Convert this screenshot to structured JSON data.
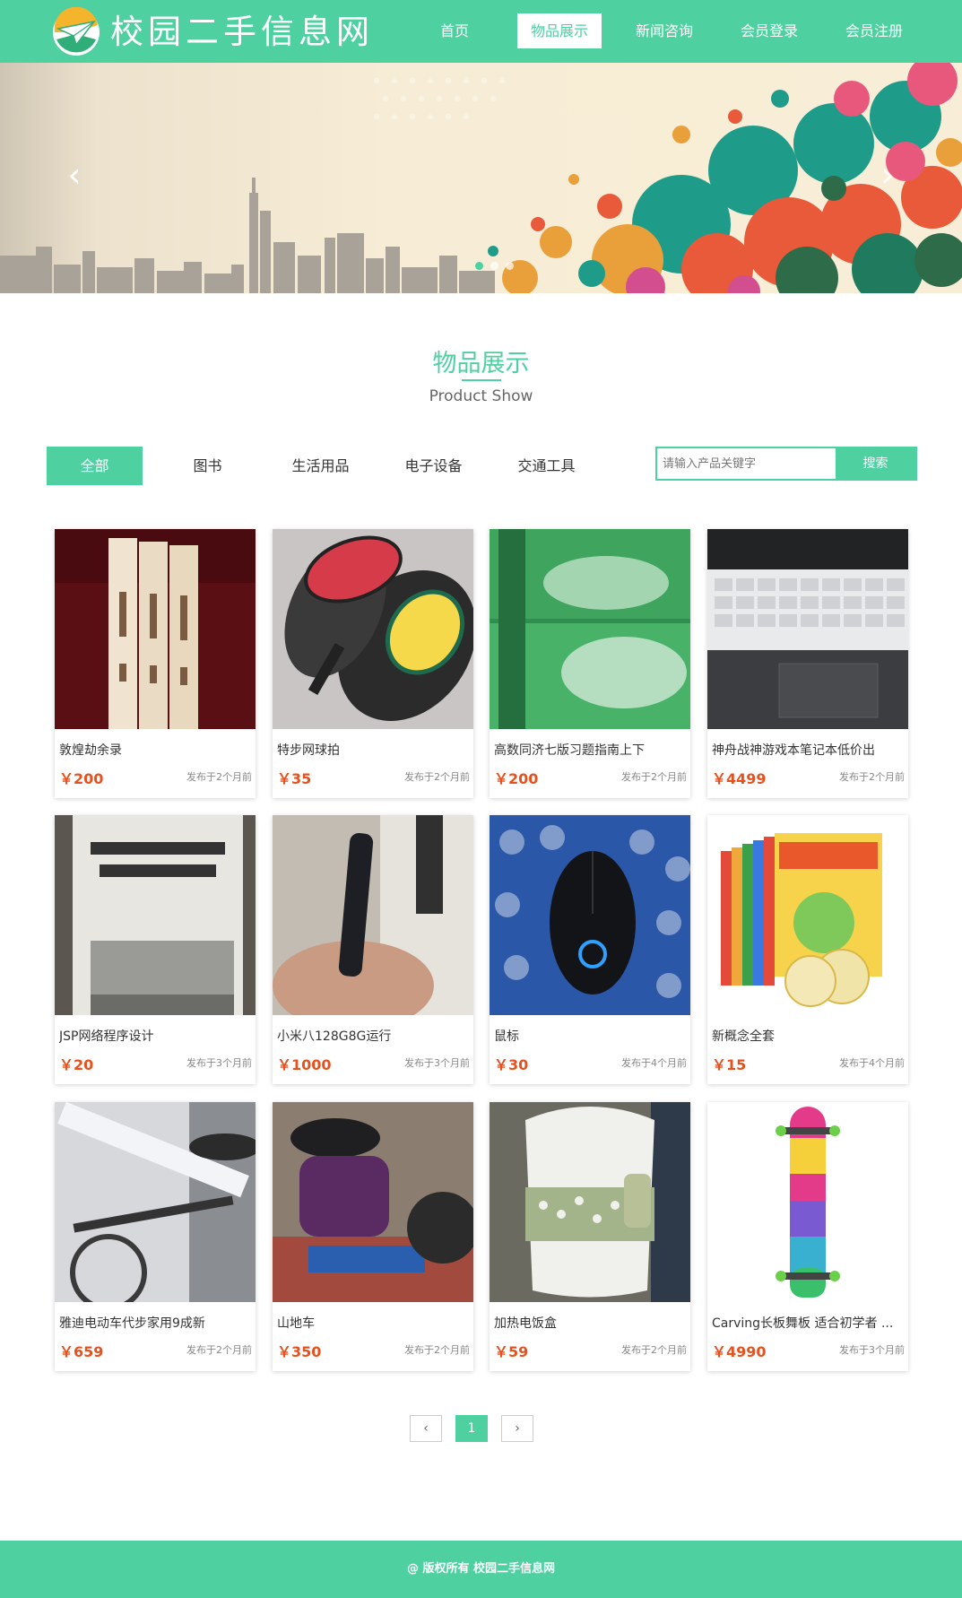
{
  "header": {
    "site_name": "校园二手信息网",
    "nav": [
      {
        "label": "首页",
        "active": false
      },
      {
        "label": "物品展示",
        "active": true
      },
      {
        "label": "新闻咨询",
        "active": false
      },
      {
        "label": "会员登录",
        "active": false
      },
      {
        "label": "会员注册",
        "active": false
      }
    ]
  },
  "banner": {
    "prev_icon": "chevron-left-icon",
    "next_icon": "chevron-right-icon",
    "slide_count": 3,
    "active_slide": 1
  },
  "section": {
    "title": "物品展示",
    "subtitle": "Product Show"
  },
  "filters": [
    {
      "label": "全部",
      "active": true
    },
    {
      "label": "图书",
      "active": false
    },
    {
      "label": "生活用品",
      "active": false
    },
    {
      "label": "电子设备",
      "active": false
    },
    {
      "label": "交通工具",
      "active": false
    }
  ],
  "search": {
    "placeholder": "请输入产品关键字",
    "button_label": "搜索"
  },
  "products": [
    {
      "name": "敦煌劫余录",
      "price": "￥200",
      "time": "发布于2个月前"
    },
    {
      "name": "特步网球拍",
      "price": "￥35",
      "time": "发布于2个月前"
    },
    {
      "name": "高数同济七版习题指南上下",
      "price": "￥200",
      "time": "发布于2个月前"
    },
    {
      "name": "神舟战神游戏本笔记本低价出",
      "price": "￥4499",
      "time": "发布于2个月前"
    },
    {
      "name": "JSP网络程序设计",
      "price": "￥20",
      "time": "发布于3个月前"
    },
    {
      "name": "小米八128G8G运行",
      "price": "￥1000",
      "time": "发布于3个月前"
    },
    {
      "name": "鼠标",
      "price": "￥30",
      "time": "发布于4个月前"
    },
    {
      "name": "新概念全套",
      "price": "￥15",
      "time": "发布于4个月前"
    },
    {
      "name": "雅迪电动车代步家用9成新",
      "price": "￥659",
      "time": "发布于2个月前"
    },
    {
      "name": "山地车",
      "price": "￥350",
      "time": "发布于2个月前"
    },
    {
      "name": "加热电饭盒",
      "price": "￥59",
      "time": "发布于2个月前"
    },
    {
      "name": "Carving长板舞板 适合初学者 ...",
      "price": "￥4990",
      "time": "发布于3个月前"
    }
  ],
  "pagination": {
    "prev": "‹",
    "current": "1",
    "next": "›"
  },
  "footer": {
    "text": "@ 版权所有 校园二手信息网"
  },
  "colors": {
    "brand": "#4fd0a0",
    "price": "#e7511e"
  }
}
